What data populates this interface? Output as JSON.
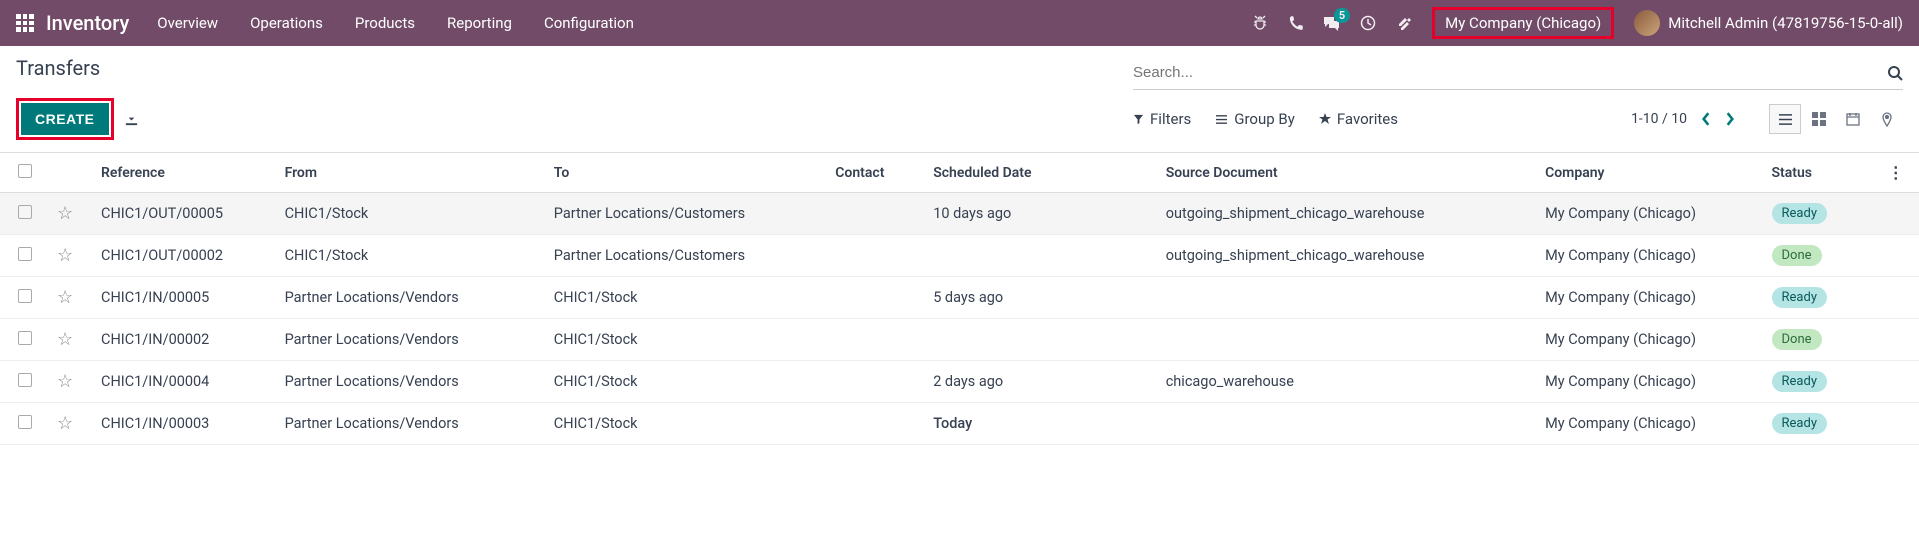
{
  "nav": {
    "brand": "Inventory",
    "menu": [
      "Overview",
      "Operations",
      "Products",
      "Reporting",
      "Configuration"
    ],
    "message_count": "5",
    "company": "My Company (Chicago)",
    "user": "Mitchell Admin (47819756-15-0-all)"
  },
  "page": {
    "title": "Transfers",
    "create_label": "CREATE",
    "search_placeholder": "Search..."
  },
  "toolbar": {
    "filters": "Filters",
    "groupby": "Group By",
    "favorites": "Favorites",
    "pager": "1-10 / 10"
  },
  "columns": {
    "reference": "Reference",
    "from": "From",
    "to": "To",
    "contact": "Contact",
    "scheduled": "Scheduled Date",
    "source": "Source Document",
    "company": "Company",
    "status": "Status"
  },
  "rows": [
    {
      "ref": "CHIC1/OUT/00005",
      "from": "CHIC1/Stock",
      "to": "Partner Locations/Customers",
      "contact": "",
      "date": "10 days ago",
      "date_class": "overdue",
      "source": "outgoing_shipment_chicago_warehouse",
      "company": "My Company (Chicago)",
      "status": "Ready",
      "status_class": "ready",
      "hover": true
    },
    {
      "ref": "CHIC1/OUT/00002",
      "from": "CHIC1/Stock",
      "to": "Partner Locations/Customers",
      "contact": "",
      "date": "",
      "date_class": "",
      "source": "outgoing_shipment_chicago_warehouse",
      "company": "My Company (Chicago)",
      "status": "Done",
      "status_class": "done"
    },
    {
      "ref": "CHIC1/IN/00005",
      "from": "Partner Locations/Vendors",
      "to": "CHIC1/Stock",
      "contact": "",
      "date": "5 days ago",
      "date_class": "overdue",
      "source": "",
      "company": "My Company (Chicago)",
      "status": "Ready",
      "status_class": "ready"
    },
    {
      "ref": "CHIC1/IN/00002",
      "from": "Partner Locations/Vendors",
      "to": "CHIC1/Stock",
      "contact": "",
      "date": "",
      "date_class": "",
      "source": "",
      "company": "My Company (Chicago)",
      "status": "Done",
      "status_class": "done"
    },
    {
      "ref": "CHIC1/IN/00004",
      "from": "Partner Locations/Vendors",
      "to": "CHIC1/Stock",
      "contact": "",
      "date": "2 days ago",
      "date_class": "overdue",
      "source": "chicago_warehouse",
      "company": "My Company (Chicago)",
      "status": "Ready",
      "status_class": "ready"
    },
    {
      "ref": "CHIC1/IN/00003",
      "from": "Partner Locations/Vendors",
      "to": "CHIC1/Stock",
      "contact": "",
      "date": "Today",
      "date_class": "today",
      "source": "",
      "company": "My Company (Chicago)",
      "status": "Ready",
      "status_class": "ready"
    }
  ]
}
